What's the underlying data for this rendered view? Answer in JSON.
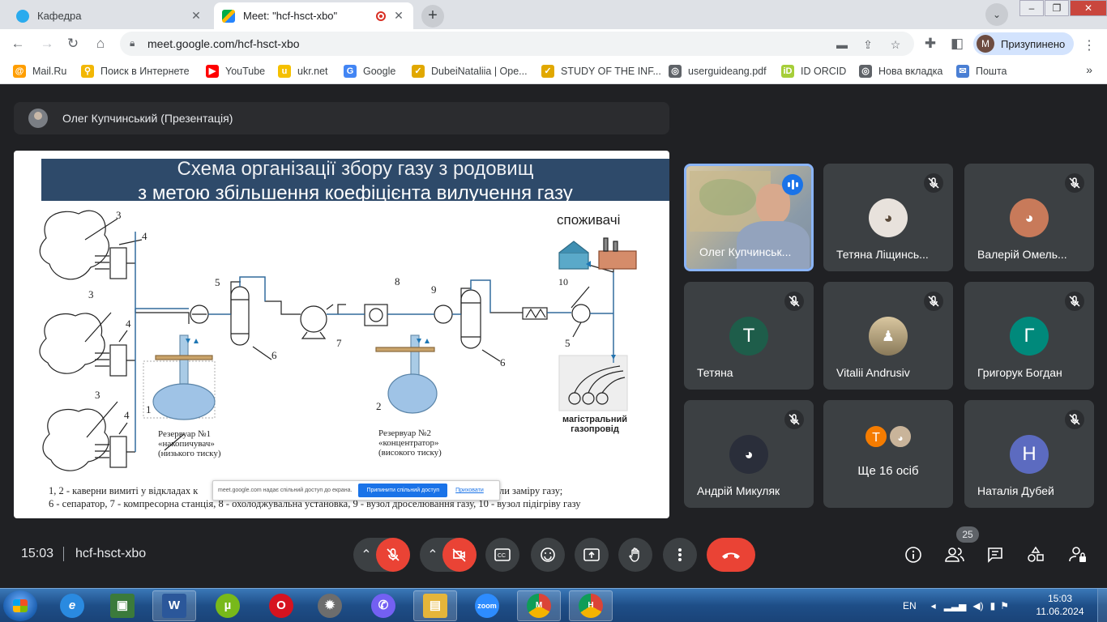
{
  "browser": {
    "tabs": [
      {
        "title": "Кафедра",
        "active": false
      },
      {
        "title": "Meet: \"hcf-hsct-xbo\"",
        "active": true
      }
    ],
    "url": "meet.google.com/hcf-hsct-xbo",
    "profile": {
      "initial": "M",
      "status": "Призупинено"
    },
    "bookmarks": [
      {
        "label": "Mail.Ru",
        "icon": "mailru-icon",
        "color": "#ff9e00"
      },
      {
        "label": "Поиск в Интернете",
        "icon": "search-magnifier-icon",
        "color": "#f2b705"
      },
      {
        "label": "YouTube",
        "icon": "youtube-icon",
        "color": "#ff0000"
      },
      {
        "label": "ukr.net",
        "icon": "ukrnet-icon",
        "color": "#f5c000"
      },
      {
        "label": "Google",
        "icon": "google-icon",
        "color": "#4285f4"
      },
      {
        "label": "DubeiNataliia | Ope...",
        "icon": "checkmark-icon",
        "color": "#e1a800"
      },
      {
        "label": "STUDY OF THE INF...",
        "icon": "checkmark-icon",
        "color": "#e1a800"
      },
      {
        "label": "userguideang.pdf",
        "icon": "globe-icon",
        "color": "#5f6368"
      },
      {
        "label": "ID ORCID",
        "icon": "orcid-icon",
        "color": "#a6ce39"
      },
      {
        "label": "Нова вкладка",
        "icon": "globe-icon",
        "color": "#5f6368"
      },
      {
        "label": "Пошта",
        "icon": "mail-icon",
        "color": "#4a7fd4"
      }
    ],
    "bookmarks_more": "»"
  },
  "meet": {
    "presenter_label": "Олег Купчинський (Презентація)",
    "time": "15:03",
    "code": "hcf-hsct-xbo",
    "participant_count": "25",
    "participants": [
      {
        "name": "Олег Купчинськ...",
        "initial": "",
        "color": "#5e6b78",
        "muted": false,
        "speaking": true
      },
      {
        "name": "Тетяна Ліщинсь...",
        "initial": "",
        "color": "#d9d2cc",
        "muted": true
      },
      {
        "name": "Валерій Омель...",
        "initial": "",
        "color": "#c87a5a",
        "muted": true
      },
      {
        "name": "Тетяна",
        "initial": "Т",
        "color": "#1e5d4a",
        "muted": true
      },
      {
        "name": "Vitalii Andrusiv",
        "initial": "",
        "color": "#c7b48c",
        "muted": true
      },
      {
        "name": "Григорук Богдан",
        "initial": "Г",
        "color": "#00897b",
        "muted": true
      },
      {
        "name": "Андрій Микуляк",
        "initial": "",
        "color": "#2a2e3a",
        "muted": true
      },
      {
        "name": "Ще 16 осіб",
        "initial": "Т",
        "color": "#f57c00",
        "muted": false
      },
      {
        "name": "Наталія Дубей",
        "initial": "Н",
        "color": "#5c6bc0",
        "muted": true
      }
    ]
  },
  "slide": {
    "title_line1": "Схема організації збору газу з родовищ",
    "title_line2": "з метою збільшення коефіцієнта вилучення газу",
    "consumers": "споживачі",
    "pipeline_line1": "магістральний",
    "pipeline_line2": "газопровід",
    "reservoir1_line1": "Резервуар №1",
    "reservoir1_line2": "«накопичувач»",
    "reservoir1_line3": "(низького тиску)",
    "reservoir2_line1": "Резервуар №2",
    "reservoir2_line2": "«концентратор»",
    "reservoir2_line3": "(високого тиску)",
    "num_labels": {
      "n1": "1",
      "n2": "2",
      "n3a": "3",
      "n3b": "3",
      "n3c": "3",
      "n4a": "4",
      "n4b": "4",
      "n4c": "4",
      "n5a": "5",
      "n5b": "5",
      "n6a": "6",
      "n6b": "6",
      "n7": "7",
      "n8": "8",
      "n9": "9",
      "n10": "10"
    },
    "caption_line1": "1, 2 - каверни вимиті у відкладах к",
    "caption_line1_tail": "вузли заміру газу;",
    "caption_line2": "6 - сепаратор, 7 - компресорна станція, 8 - охолоджувальна установка, 9 - вузол дроселювання газу, 10 - вузол підігріву газу",
    "share_notice": "meet.google.com надає спільний доступ до екрана.",
    "share_stop": "Припинити спільний доступ",
    "share_hide": "Приховати"
  },
  "taskbar": {
    "lang": "EN",
    "time": "15:03",
    "date": "11.06.2024",
    "apps": [
      {
        "name": "ie-icon",
        "label": "e",
        "color": "#2a8ae0"
      },
      {
        "name": "computer-icon",
        "label": "▣",
        "color": "#3b7a3b"
      },
      {
        "name": "word-icon",
        "label": "W",
        "color": "#2b579a"
      },
      {
        "name": "utorrent-icon",
        "label": "µ",
        "color": "#78b91a"
      },
      {
        "name": "opera-icon",
        "label": "O",
        "color": "#d6131f"
      },
      {
        "name": "settings-gear-icon",
        "label": "✹",
        "color": "#6d6d6d"
      },
      {
        "name": "viber-icon",
        "label": "✆",
        "color": "#7360f2"
      },
      {
        "name": "folder-icon",
        "label": "▤",
        "color": "#e5b53a"
      },
      {
        "name": "zoom-icon",
        "label": "zoom",
        "color": "#2d8cff"
      },
      {
        "name": "chrome-icon-m",
        "label": "M",
        "color": "#db4437"
      },
      {
        "name": "chrome-icon-h",
        "label": "H",
        "color": "#0f9d58"
      }
    ]
  }
}
